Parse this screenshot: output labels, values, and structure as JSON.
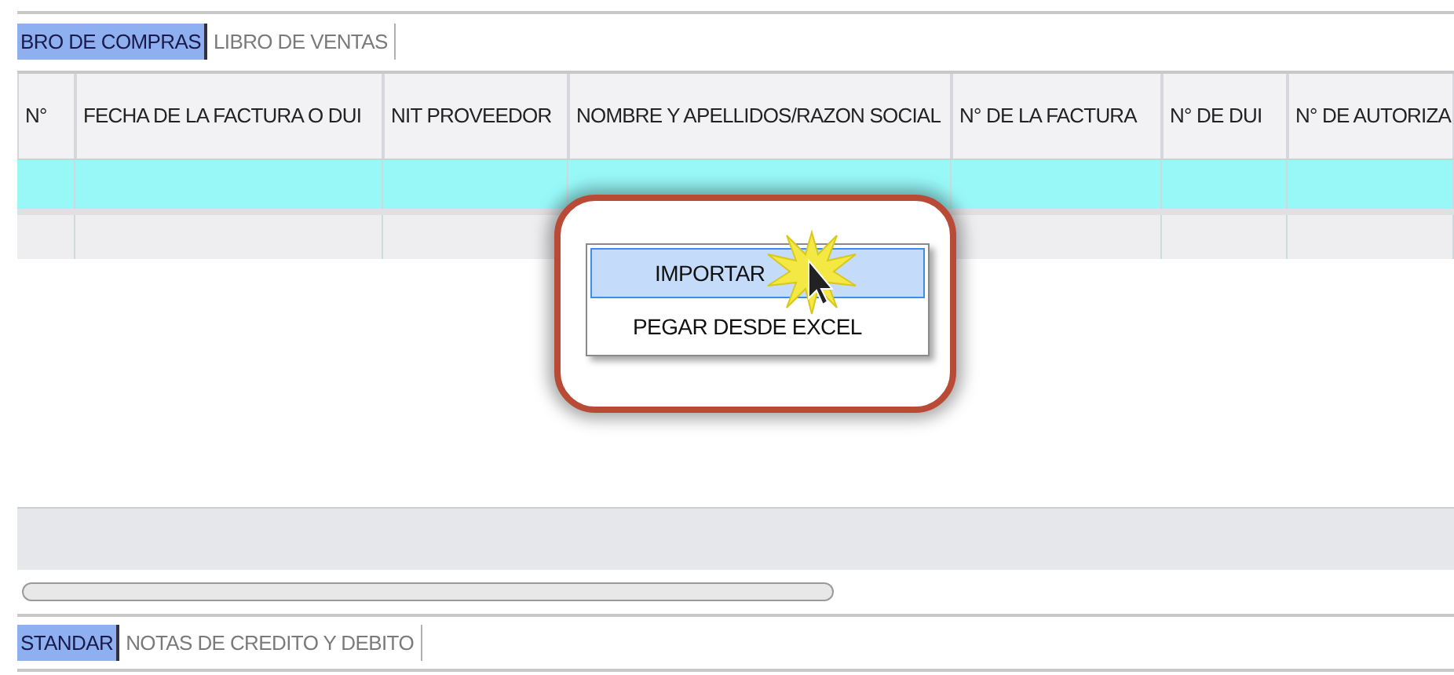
{
  "top_tabs": [
    {
      "label": "BRO DE COMPRAS",
      "selected": true
    },
    {
      "label": "LIBRO DE VENTAS",
      "selected": false
    }
  ],
  "table": {
    "columns": [
      "N°",
      "FECHA DE LA FACTURA O DUI",
      "NIT PROVEEDOR",
      "NOMBRE Y APELLIDOS/RAZON SOCIAL",
      "N° DE LA FACTURA",
      "N° DE DUI",
      "N° DE AUTORIZA"
    ],
    "rows": [
      {
        "selected": true
      },
      {
        "selected": false
      }
    ]
  },
  "context_menu": {
    "items": [
      {
        "label": "IMPORTAR",
        "selected": true
      },
      {
        "label": "PEGAR DESDE EXCEL",
        "selected": false
      }
    ]
  },
  "bottom_tabs": [
    {
      "label": "STANDAR",
      "selected": true
    },
    {
      "label": "NOTAS DE CREDITO Y DEBITO",
      "selected": false
    }
  ]
}
